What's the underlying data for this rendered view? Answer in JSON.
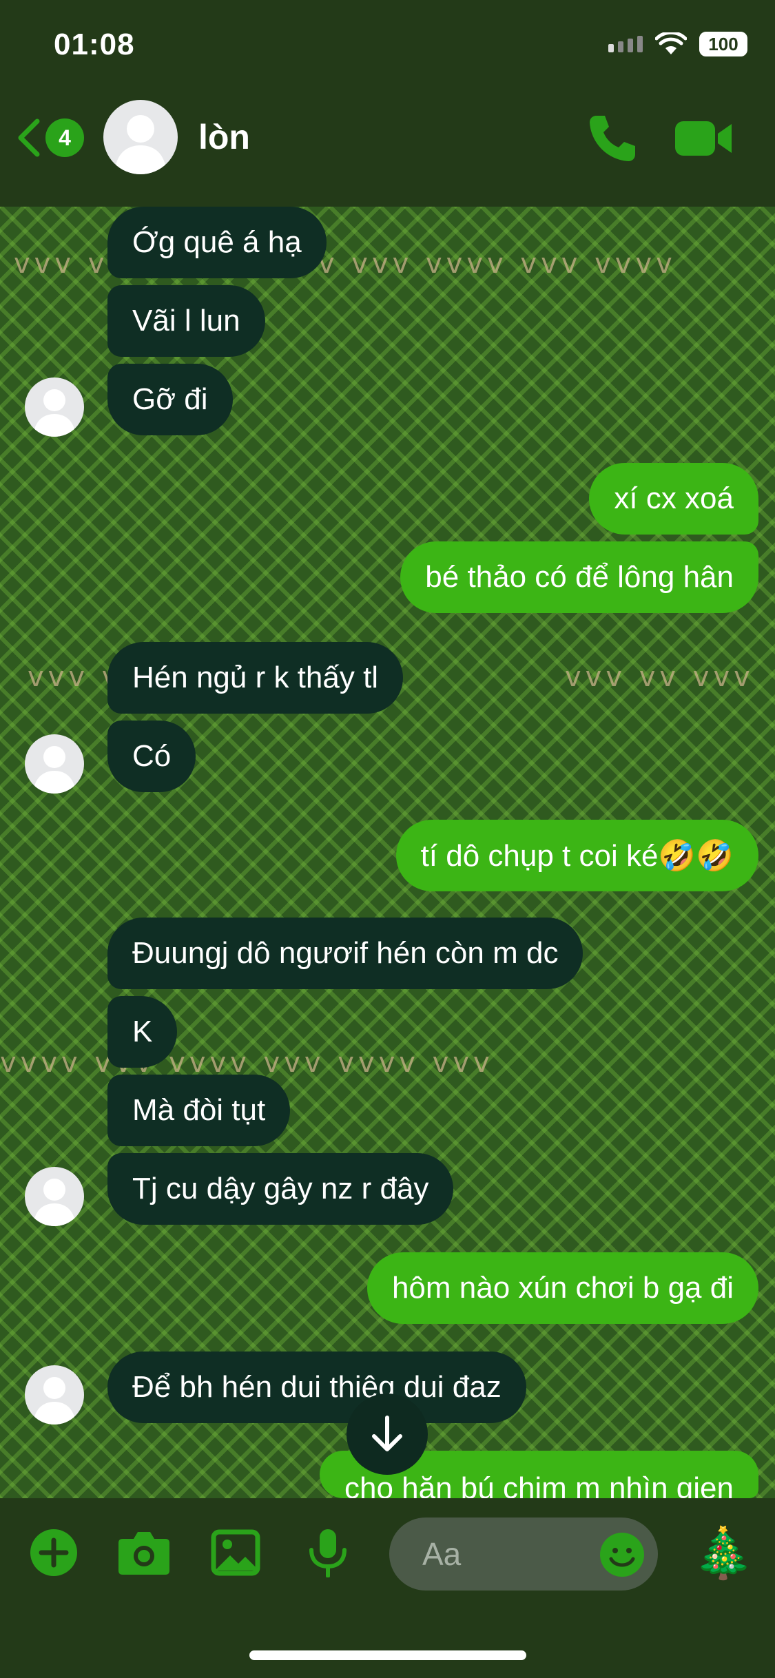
{
  "status_bar": {
    "time": "01:08",
    "battery": "100"
  },
  "header": {
    "back_badge": "4",
    "contact_name": "lòn"
  },
  "messages": [
    {
      "side": "in",
      "text": "Ớg quê á hạ"
    },
    {
      "side": "in",
      "text": "Vãi l lun"
    },
    {
      "side": "in",
      "text": "Gỡ đi"
    },
    {
      "side": "out",
      "text": "xí cx xoá"
    },
    {
      "side": "out",
      "text": "bé thảo có để lông hân"
    },
    {
      "side": "in",
      "text": "Hén ngủ r k thấy tl"
    },
    {
      "side": "in",
      "text": "Có"
    },
    {
      "side": "out",
      "text": "tí dô chụp t coi ké🤣🤣"
    },
    {
      "side": "in",
      "text": "Đuungj dô ngươif hén còn m dc"
    },
    {
      "side": "in",
      "text": "K"
    },
    {
      "side": "in",
      "text": "Mà đòi tụt"
    },
    {
      "side": "in",
      "text": "Tj cu dậy gây nz r đây"
    },
    {
      "side": "out",
      "text": "hôm nào xún chơi b gạ đi"
    },
    {
      "side": "in",
      "text": "Để bh hén dui thiệg dui đaz"
    },
    {
      "side": "out",
      "text": "cho hăn bú chim m nhìn gien"
    }
  ],
  "composer": {
    "placeholder": "Aa",
    "value": "",
    "sticker": "🎄"
  },
  "colors": {
    "incoming": "#0f2e24",
    "outgoing": "#3cb515",
    "accent": "#2aa31a"
  },
  "icons": [
    "back-chevron-icon",
    "phone-icon",
    "video-camera-icon",
    "plus-icon",
    "camera-icon",
    "gallery-icon",
    "microphone-icon",
    "emoji-icon",
    "arrow-down-icon"
  ]
}
